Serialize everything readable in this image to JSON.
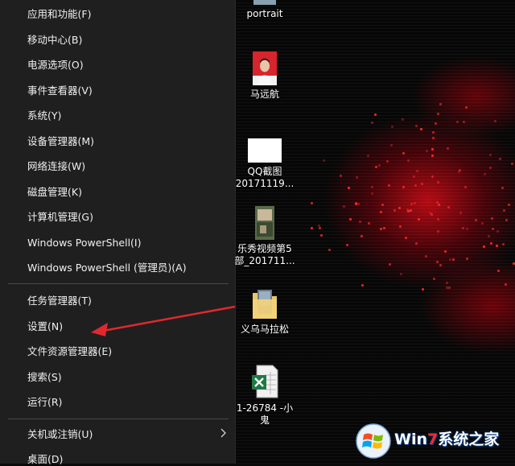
{
  "menu": {
    "items": [
      {
        "label": "应用和功能(F)"
      },
      {
        "label": "移动中心(B)"
      },
      {
        "label": "电源选项(O)"
      },
      {
        "label": "事件查看器(V)"
      },
      {
        "label": "系统(Y)"
      },
      {
        "label": "设备管理器(M)"
      },
      {
        "label": "网络连接(W)"
      },
      {
        "label": "磁盘管理(K)"
      },
      {
        "label": "计算机管理(G)"
      },
      {
        "label": "Windows PowerShell(I)"
      },
      {
        "label": "Windows PowerShell (管理员)(A)"
      },
      {
        "label": "任务管理器(T)"
      },
      {
        "label": "设置(N)"
      },
      {
        "label": "文件资源管理器(E)"
      },
      {
        "label": "搜索(S)"
      },
      {
        "label": "运行(R)"
      },
      {
        "label": "关机或注销(U)"
      },
      {
        "label": "桌面(D)"
      }
    ]
  },
  "desktop": {
    "icons": [
      {
        "label_lines": [
          "portrait"
        ],
        "icon": "portrait-image-icon"
      },
      {
        "label_lines": [
          "马远航"
        ],
        "icon": "photo-person-icon"
      },
      {
        "label_lines": [
          "QQ截图",
          "20171119..."
        ],
        "icon": "screenshot-image-icon"
      },
      {
        "label_lines": [
          "乐秀视频第5",
          "部_201711..."
        ],
        "icon": "video-thumbnail-icon"
      },
      {
        "label_lines": [
          "义乌马拉松"
        ],
        "icon": "folder-icon"
      },
      {
        "label_lines": [
          "1-26784 -小",
          "鬼"
        ],
        "icon": "excel-file-icon"
      }
    ]
  },
  "watermark": {
    "win": "Win",
    "seven": "7",
    "rest": "系统之家",
    "icon": "windows-logo-icon"
  },
  "colors": {
    "menu_bg": "#1f1f1f",
    "menu_text": "#f0f0f0",
    "separator": "#4a4a4a",
    "arrow": "#e0282e",
    "desktop_red": "#c00a14"
  }
}
